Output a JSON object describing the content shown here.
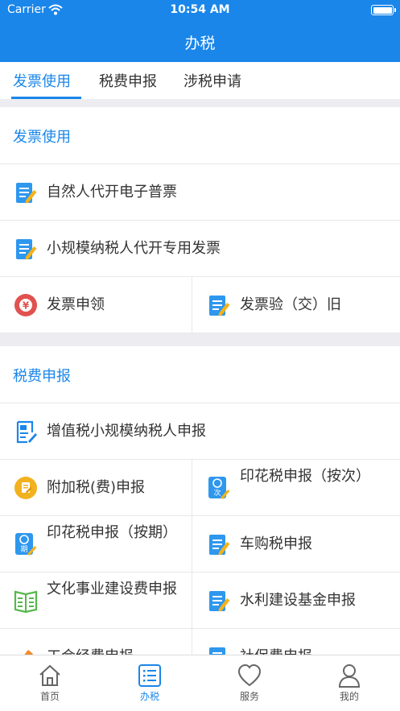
{
  "status_bar": {
    "carrier": "Carrier",
    "time": "10:54 AM"
  },
  "nav": {
    "title": "办税"
  },
  "tabs": [
    {
      "label": "发票使用",
      "active": true
    },
    {
      "label": "税费申报",
      "active": false
    },
    {
      "label": "涉税申请",
      "active": false
    }
  ],
  "sections": [
    {
      "title": "发票使用",
      "items": [
        {
          "label": "自然人代开电子普票",
          "icon": "document-pen-icon"
        },
        {
          "label": "小规模纳税人代开专用发票",
          "icon": "document-pen-icon"
        },
        {
          "label": "发票申领",
          "icon": "yuan-coin-icon"
        },
        {
          "label": "发票验（交）旧",
          "icon": "document-pen-icon"
        }
      ]
    },
    {
      "title": "税费申报",
      "items": [
        {
          "label": "增值税小规模纳税人申报",
          "icon": "vat-document-icon"
        },
        {
          "label": "附加税(费)申报",
          "icon": "surtax-coin-icon"
        },
        {
          "label": "印花税申报（按次）",
          "icon": "stamp-ci-icon",
          "badge": "次"
        },
        {
          "label": "印花税申报（按期）",
          "icon": "stamp-qi-icon",
          "badge": "期"
        },
        {
          "label": "车购税申报",
          "icon": "document-pen-icon"
        },
        {
          "label": "文化事业建设费申报",
          "icon": "book-icon"
        },
        {
          "label": "水利建设基金申报",
          "icon": "document-pen-icon"
        },
        {
          "label": "工会经费申报",
          "icon": "pencil-icon"
        },
        {
          "label": "社保费申报",
          "icon": "document-pen-icon"
        }
      ]
    }
  ],
  "tabbar": [
    {
      "label": "首页",
      "icon": "home-icon",
      "active": false
    },
    {
      "label": "办税",
      "icon": "list-icon",
      "active": true
    },
    {
      "label": "服务",
      "icon": "heart-icon",
      "active": false
    },
    {
      "label": "我的",
      "icon": "person-icon",
      "active": false
    }
  ],
  "colors": {
    "primary": "#1a86ea",
    "icon_blue": "#2e97ee",
    "pen_yellow": "#f5b21a",
    "coin_red": "#e0524f",
    "coin_yellow": "#f2b11e",
    "book_green": "#55b84a"
  }
}
